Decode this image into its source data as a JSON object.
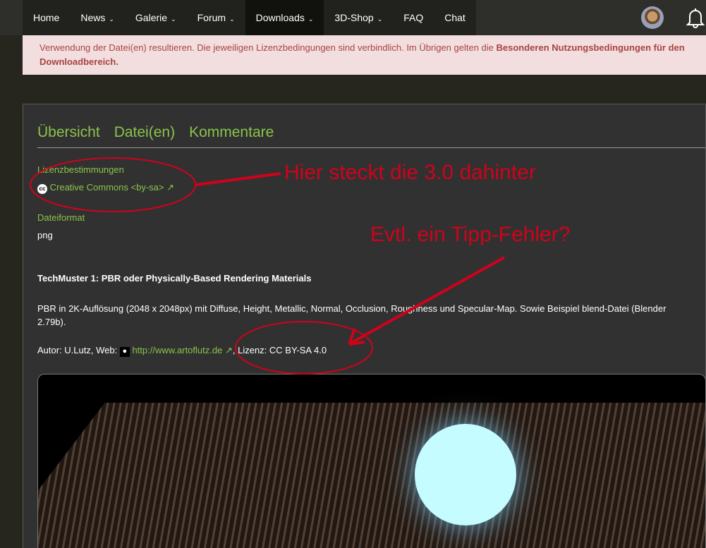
{
  "nav": {
    "items": [
      {
        "label": "Home"
      },
      {
        "label": "News",
        "chevron": true
      },
      {
        "label": "Galerie",
        "chevron": true
      },
      {
        "label": "Forum",
        "chevron": true
      },
      {
        "label": "Downloads",
        "chevron": true,
        "active": true
      },
      {
        "label": "3D-Shop",
        "chevron": true
      },
      {
        "label": "FAQ"
      },
      {
        "label": "Chat"
      }
    ]
  },
  "notice": {
    "text": "Verwendung der Datei(en) resultieren. Die jeweiligen Lizenzbedingungen sind verbindlich. Im Übrigen gelten die ",
    "link": "Besonderen Nutzungsbedingungen für den Downloadbereich."
  },
  "tabs": [
    "Übersicht",
    "Datei(en)",
    "Kommentare"
  ],
  "license": {
    "label": "Lizenzbestimmungen",
    "value": "Creative Commons <by-sa>"
  },
  "format": {
    "label": "Dateiformat",
    "value": "png"
  },
  "description": {
    "title": "TechMuster 1: PBR oder Physically-Based Rendering Materials",
    "body": "PBR in 2K-Auflösung (2048 x 2048px) mit Diffuse, Height, Metallic, Normal, Occlusion, Roughness und Specular-Map. Sowie Beispiel blend-Datei (Blender 2.79b).",
    "author_prefix": "Autor: U.Lutz, Web: ",
    "author_link": "http://www.artoflutz.de",
    "license_text": ", Lizenz: CC BY-SA 4.0"
  },
  "annotations": {
    "first": "Hier steckt die 3.0 dahinter",
    "second": "Evtl. ein Tipp-Fehler?"
  },
  "colors": {
    "accent": "#8bc34a",
    "annotation": "#d0021b"
  }
}
